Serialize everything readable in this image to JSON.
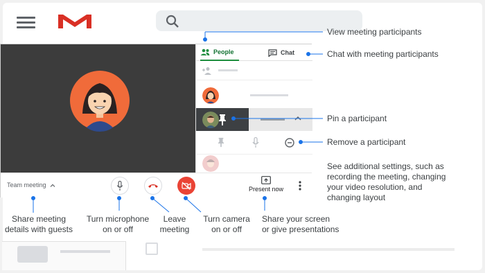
{
  "meeting": {
    "tabs": {
      "people": "People",
      "chat": "Chat"
    },
    "team_meeting": "Team meeting",
    "present_now": "Present now"
  },
  "annotations": {
    "view_participants": "View meeting participants",
    "chat": "Chat with meeting participants",
    "pin": "Pin a participant",
    "remove": "Remove a participant",
    "settings": [
      "See additional settings, such as",
      "recording the meeting, changing",
      "your video resolution, and",
      "changing layout"
    ],
    "share_details": [
      "Share meeting",
      "details with guests"
    ],
    "mic": [
      "Turn microphone",
      "on or off"
    ],
    "leave": [
      "Leave",
      "meeting"
    ],
    "camera": [
      "Turn camera",
      "on or off"
    ],
    "share_screen": [
      "Share your screen",
      "or give presentations"
    ]
  },
  "colors": {
    "accent_green": "#1e8e3e",
    "connector_blue": "#1a73e8",
    "leave_red": "#d93025",
    "camera_red": "#ea4335",
    "video_bg": "#3c3c3c"
  },
  "icons": [
    "hamburger-icon",
    "gmail-logo",
    "search-icon",
    "people-icon",
    "chat-icon",
    "add-person-icon",
    "pin-icon",
    "mic-icon",
    "remove-icon",
    "expand-icon",
    "chevron-up-icon",
    "phone-hangup-icon",
    "camera-off-icon",
    "present-icon",
    "more-vert-icon"
  ]
}
